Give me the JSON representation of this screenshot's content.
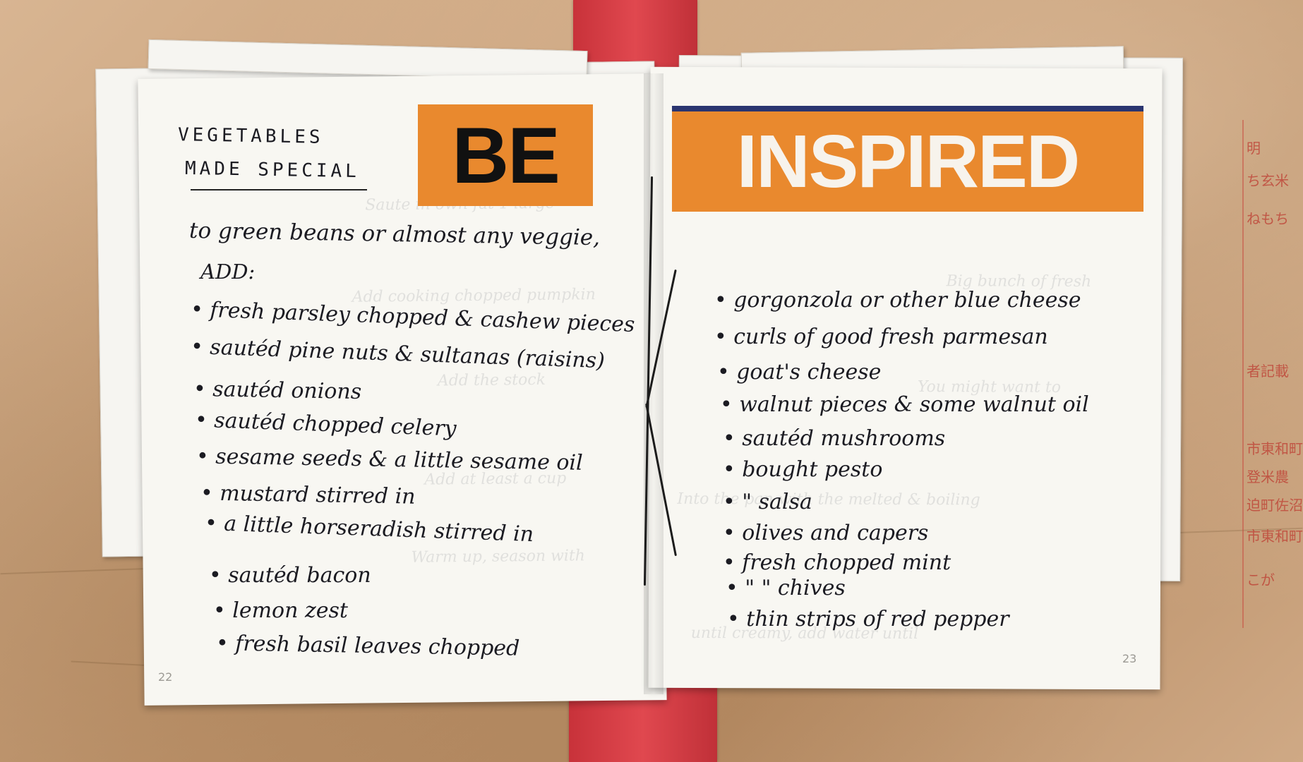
{
  "left_page": {
    "heading_line1": "VEGETABLES",
    "heading_line2": "MADE SPECIAL",
    "intro_line1": "to green beans or almost any veggie,",
    "intro_line2": "ADD:",
    "items": [
      "• fresh parsley chopped & cashew pieces",
      "• sautéd pine nuts & sultanas (raisins)",
      "• sautéd onions",
      "• sautéd chopped celery",
      "• sesame seeds & a little sesame oil",
      "• mustard stirred in",
      "• a little horseradish stirred in",
      "• sautéd bacon",
      "• lemon zest",
      "• fresh basil leaves chopped"
    ],
    "page_number": "22"
  },
  "right_page": {
    "items": [
      "• gorgonzola or other blue cheese",
      "• curls of good fresh parmesan",
      "• goat's cheese",
      "• walnut pieces & some walnut oil",
      "• sautéd mushrooms",
      "• bought pesto",
      "• \"  salsa",
      "• olives and capers",
      "• fresh chopped mint",
      "• \"   \"  chives",
      "• thin strips of red pepper"
    ],
    "page_number": "23"
  },
  "banner": {
    "be": "BE",
    "inspired": "INSPIRED",
    "color": "#e9892e"
  },
  "stamp": {
    "lines": [
      "明",
      "ち玄米",
      "ねもち",
      "者記載",
      "市東和町",
      "登米農",
      "迫町佐沼",
      "市東和町",
      "こが"
    ]
  },
  "colors": {
    "tape": "#d13a42",
    "kraft": "#c9a27c",
    "paper": "#f8f7f2",
    "ink": "#1b1b22"
  }
}
